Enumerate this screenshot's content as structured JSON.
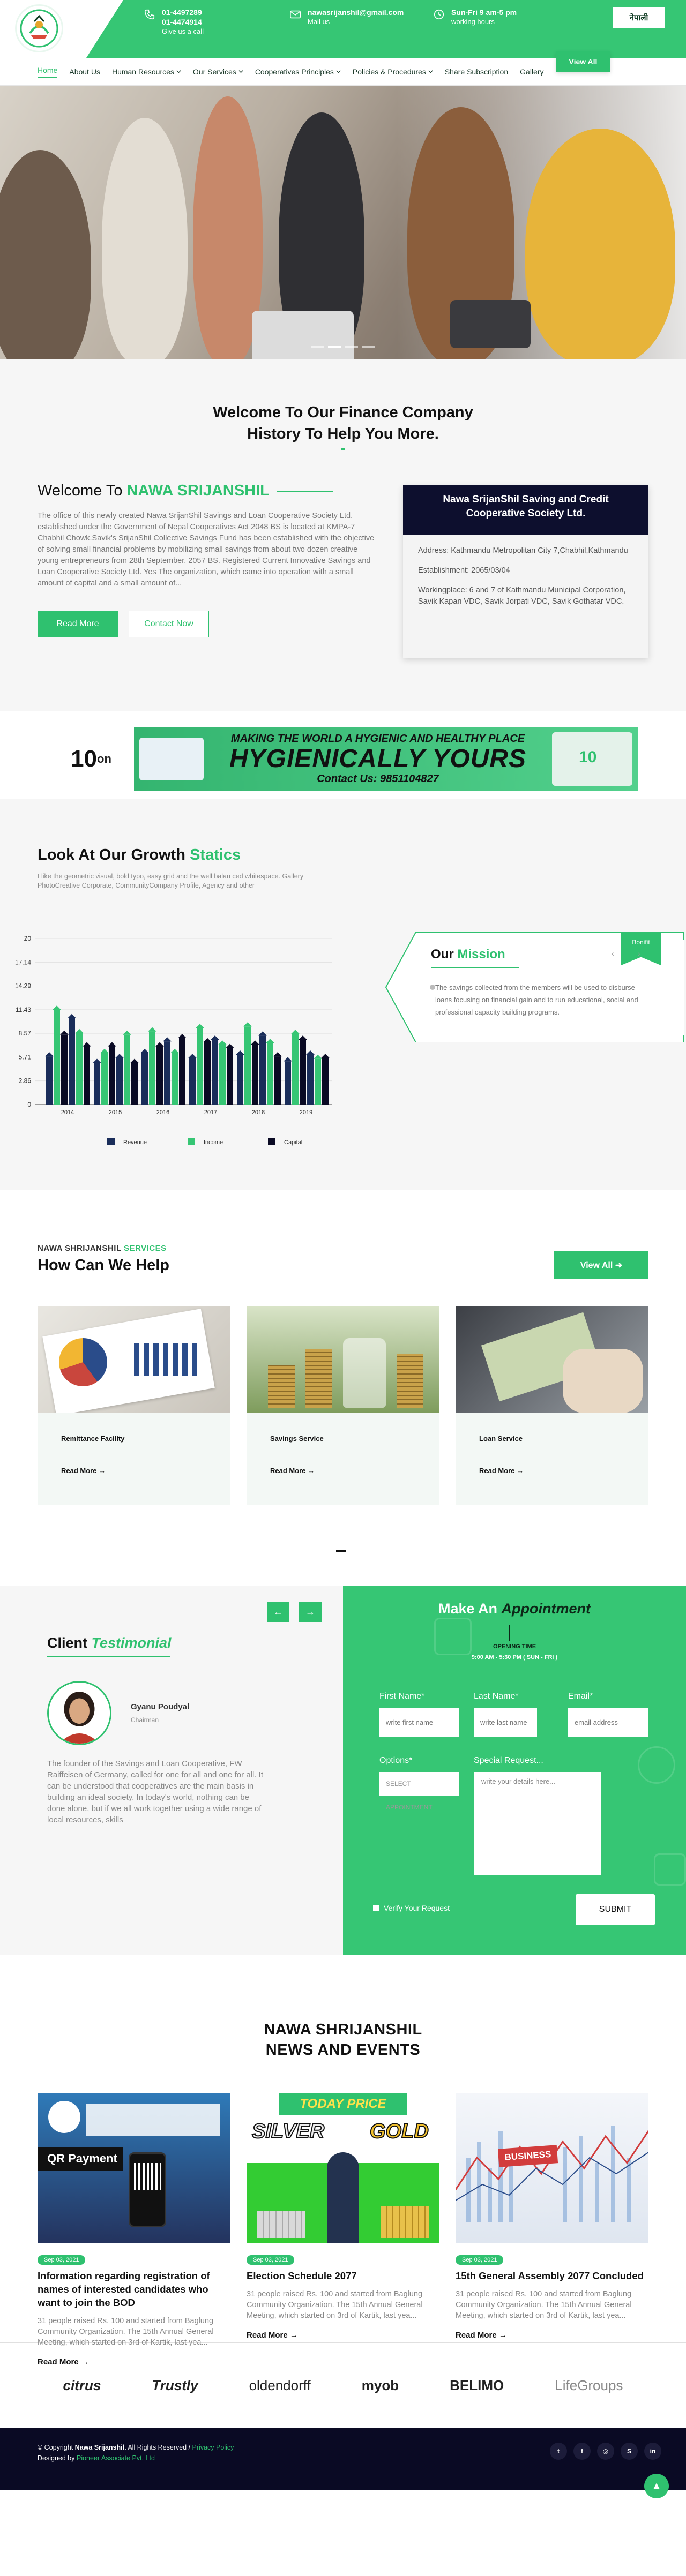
{
  "header": {
    "phone": {
      "line1": "01-4497289",
      "line2": "01-4474914",
      "line3": "Give us a call"
    },
    "mail": {
      "line1": "nawasrijanshil@gmail.com",
      "line2": "Mail us"
    },
    "hours": {
      "line1": "Sun-Fri 9 am-5 pm",
      "line2": "working hours"
    },
    "lang_label": "नेपाली",
    "view_all": "View All"
  },
  "nav": [
    {
      "label": "Home",
      "active": true,
      "dropdown": false
    },
    {
      "label": "About Us",
      "dropdown": false
    },
    {
      "label": "Human Resources",
      "dropdown": true
    },
    {
      "label": "Our Services",
      "dropdown": true
    },
    {
      "label": "Cooperatives Principles",
      "dropdown": true
    },
    {
      "label": "Policies & Procedures",
      "dropdown": true
    },
    {
      "label": "Share Subscription",
      "dropdown": false
    },
    {
      "label": "Gallery",
      "dropdown": false
    }
  ],
  "welcome": {
    "title_line1": "Welcome To Our Finance Company",
    "title_line2": "History To Help You More.",
    "heading_prefix": "Welcome To",
    "heading_brand": "NAWA SRIJANSHIL",
    "body": "The office of this newly created Nawa SrijanShil Savings and Loan Cooperative Society Ltd. established under the Government of Nepal Cooperatives Act 2048 BS is located at KMPA-7 Chabhil Chowk.Savik's SrijanShil Collective Savings Fund has been established with the objective of solving small financial problems by mobilizing small savings from about two dozen creative young entrepreneurs from 28th September, 2057 BS. Registered Current Innovative Savings and Loan Cooperative Society Ltd. Yes The organization, which came into operation with a small amount of capital and a small amount of...",
    "read_more": "Read More",
    "contact_now": "Contact Now"
  },
  "info_card": {
    "title": "Nawa SrijanShil Saving and Credit Cooperative Society Ltd.",
    "address": "Address: Kathmandu Metropolitan City 7,Chabhil,Kathmandu",
    "established": "Establishment: 2065/03/04",
    "working": "Workingplace: 6 and 7 of Kathmandu Municipal Corporation, Savik Kapan VDC, Savik Jorpati VDC, Savik Gothatar VDC."
  },
  "ad": {
    "brand": "10",
    "brand_sub": "on",
    "line1": "MAKING THE WORLD A HYGIENIC AND HEALTHY PLACE",
    "line2": "HYGIENICALLY YOURS",
    "line3": "Contact Us: 9851104827",
    "box_label": "10"
  },
  "growth": {
    "title_prefix": "Look At Our Growth",
    "title_accent": "Statics",
    "subtitle": "I like the geometric visual, bold typo, easy grid and the well balan ced whitespace. Gallery PhotoCreative Corporate, CommunityCompany Profile, Agency and other"
  },
  "chart_data": {
    "type": "bar",
    "categories": [
      "2014",
      "2015",
      "2016",
      "2017",
      "2018",
      "2019"
    ],
    "series": [
      {
        "name": "Revenue",
        "color": "#1a2d5a",
        "values": [
          [
            5.8,
            10.4
          ],
          [
            5.0,
            5.6
          ],
          [
            6.2,
            7.6
          ],
          [
            5.6,
            7.8
          ],
          [
            6.0,
            8.3
          ],
          [
            5.2,
            6.0
          ]
        ]
      },
      {
        "name": "Income",
        "color": "#36c674",
        "values": [
          [
            11.4,
            8.6
          ],
          [
            6.2,
            8.4
          ],
          [
            8.8,
            6.2
          ],
          [
            9.2,
            7.2
          ],
          [
            9.4,
            7.4
          ],
          [
            8.5,
            5.5
          ]
        ]
      },
      {
        "name": "Capital",
        "color": "#0a0a24",
        "values": [
          [
            8.4,
            7.0
          ],
          [
            7.0,
            5.0
          ],
          [
            7.0,
            8.0
          ],
          [
            7.5,
            6.8
          ],
          [
            7.2,
            5.8
          ],
          [
            7.8,
            5.6
          ]
        ]
      }
    ],
    "yticks": [
      0,
      2.86,
      5.71,
      8.57,
      11.43,
      14.29,
      17.14,
      20
    ],
    "ylim": [
      0,
      20
    ],
    "legend_position": "bottom",
    "grid": true
  },
  "mission": {
    "title_prefix": "Our",
    "title_accent": "Mission",
    "ribbon": "Bonifit",
    "text": "The savings collected from the members will be used to disburse loans focusing on financial gain and to run educational, social and professional capacity building programs."
  },
  "services": {
    "kicker_prefix": "NAWA SHRIJANSHIL",
    "kicker_accent": "SERVICES",
    "title": "How Can We Help",
    "view_all": "View All",
    "cards": [
      {
        "title": "Remittance Facility",
        "read_more": "Read More"
      },
      {
        "title": "Savings Service",
        "read_more": "Read More"
      },
      {
        "title": "Loan Service",
        "read_more": "Read More"
      }
    ]
  },
  "testimonial": {
    "title_prefix": "Client",
    "title_accent": "Testimonial",
    "name": "Gyanu Poudyal",
    "role": "Chairman",
    "quote": "The founder of the Savings and Loan Cooperative, FW Raiffeisen of Germany, called for one for all and one for all. It can be understood that cooperatives are the main basis in building an ideal society. In today's world, nothing can be done alone, but if we all work together using a wide range of local resources, skills"
  },
  "appointment": {
    "title_prefix": "Make An",
    "title_accent": "Appointment",
    "opening_label": "OPENING TIME",
    "opening_hours": "9:00 AM - 5:30 PM ( SUN - FRI )",
    "first_name_label": "First Name*",
    "first_name_placeholder": "write first name",
    "last_name_label": "Last Name*",
    "last_name_placeholder": "write last name",
    "email_label": "Email*",
    "email_placeholder": "email address",
    "options_label": "Options*",
    "options_selected": "SELECT APPOINTMENT",
    "special_label": "Special Request...",
    "special_placeholder": "write your details here...",
    "verify_label": "Verify Your Request",
    "submit": "SUBMIT"
  },
  "news": {
    "title_line1": "NAWA SHRIJANSHIL",
    "title_line2": "NEWS AND EVENTS",
    "items": [
      {
        "date": "Sep 03, 2021",
        "title": "Information regarding registration of names of interested candidates who want to join the BOD",
        "excerpt": "31 people raised Rs. 100 and started from Baglung Community Organization. The 15th Annual General Meeting, which started on 3rd of Kartik, last yea...",
        "read_more": "Read More",
        "img_label": "QR Payment"
      },
      {
        "date": "Sep 03, 2021",
        "title": "Election Schedule 2077",
        "excerpt": "31 people raised Rs. 100 and started from Baglung Community Organization. The 15th Annual General Meeting, which started on 3rd of Kartik, last yea...",
        "read_more": "Read More",
        "img_label1": "TODAY PRICE",
        "img_label2": "SILVER",
        "img_label3": "GOLD"
      },
      {
        "date": "Sep 03, 2021",
        "title": "15th General Assembly 2077 Concluded",
        "excerpt": "31 people raised Rs. 100 and started from Baglung Community Organization. The 15th Annual General Meeting, which started on 3rd of Kartik, last yea...",
        "read_more": "Read More",
        "img_label": "BUSINESS"
      }
    ]
  },
  "partners": [
    "citrus",
    "Trustly",
    "oldendorff",
    "myob",
    "BELIMO",
    "LifeGroups"
  ],
  "footer": {
    "copyright_prefix": "© Copyright",
    "brand": "Nawa Srijanshil.",
    "rights": "All Rights Reserved /",
    "privacy": "Privacy Policy",
    "designed_prefix": "Designed by",
    "designer": "Pioneer Associate Pvt. Ltd",
    "social": [
      "twitter",
      "facebook",
      "instagram",
      "skype",
      "linkedin"
    ]
  },
  "colors": {
    "accent": "#2fc16f",
    "header_green": "#36c674",
    "navy": "#0d0f2e"
  }
}
